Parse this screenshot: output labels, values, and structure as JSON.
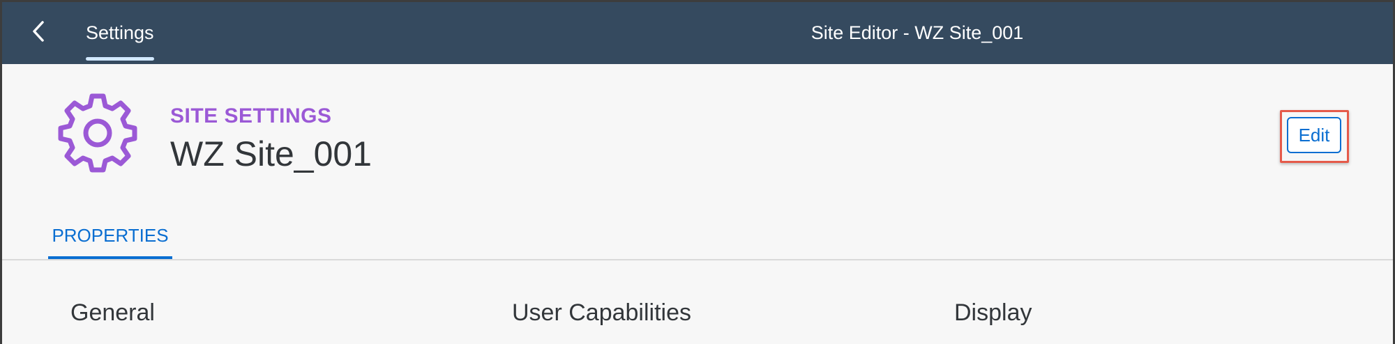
{
  "shellbar": {
    "back_icon": "chevron-left-icon",
    "nav_tab_label": "Settings",
    "title": "Site Editor - WZ Site_001",
    "background": "#354a5f"
  },
  "header": {
    "icon": "gear-icon",
    "overline": "SITE SETTINGS",
    "title": "WZ Site_001",
    "edit_label": "Edit",
    "icon_color": "#9b59d6",
    "accent": "#0a6ed1"
  },
  "tabs": [
    {
      "label": "PROPERTIES",
      "selected": true
    }
  ],
  "sections": [
    {
      "title": "General"
    },
    {
      "title": "User Capabilities"
    },
    {
      "title": "Display"
    }
  ]
}
